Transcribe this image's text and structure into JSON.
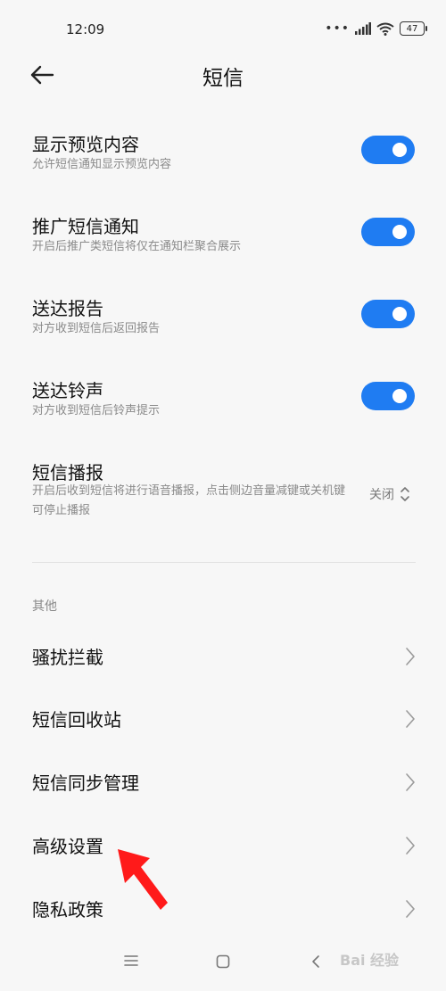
{
  "status_bar": {
    "time": "12:09",
    "battery": "47"
  },
  "header": {
    "title": "短信"
  },
  "settings": [
    {
      "title": "显示预览内容",
      "desc": "允许短信通知显示预览内容",
      "on": true
    },
    {
      "title": "推广短信通知",
      "desc": "开启后推广类短信将仅在通知栏聚合展示",
      "on": true
    },
    {
      "title": "送达报告",
      "desc": "对方收到短信后返回报告",
      "on": true
    },
    {
      "title": "送达铃声",
      "desc": "对方收到短信后铃声提示",
      "on": true
    }
  ],
  "broadcast": {
    "title": "短信播报",
    "desc": "开启后收到短信将进行语音播报，点击侧边音量减键或关机键可停止播报",
    "value": "关闭"
  },
  "section": {
    "label": "其他"
  },
  "menu": [
    {
      "label": "骚扰拦截"
    },
    {
      "label": "短信回收站"
    },
    {
      "label": "短信同步管理"
    },
    {
      "label": "高级设置"
    },
    {
      "label": "隐私政策"
    }
  ],
  "watermark": "Bai 经验",
  "colors": {
    "accent": "#1f7cf2",
    "annotation_arrow": "#ff1a1a"
  }
}
